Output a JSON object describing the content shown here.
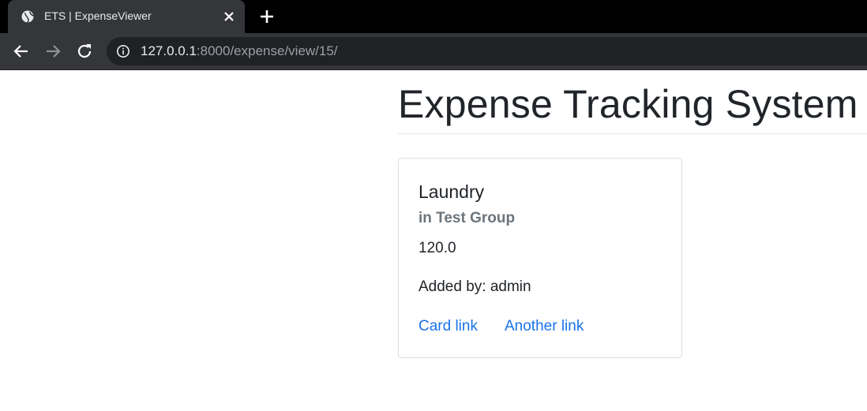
{
  "browser": {
    "tab": {
      "title": "ETS | ExpenseViewer",
      "favicon_icon": "globe-icon",
      "close_icon": "close-icon"
    },
    "new_tab_icon": "plus-icon",
    "nav": {
      "back_icon": "arrow-left-icon",
      "forward_icon": "arrow-right-icon",
      "reload_icon": "reload-icon"
    },
    "address_bar": {
      "info_icon": "info-icon",
      "host": "127.0.0.1",
      "path": ":8000/expense/view/15/"
    }
  },
  "page": {
    "title": "Expense Tracking System",
    "card": {
      "title": "Laundry",
      "subtitle": "in Test Group",
      "amount": "120.0",
      "added_by": "Added by: admin",
      "links": [
        "Card link",
        "Another link"
      ]
    }
  },
  "colors": {
    "link": "#1a73e8",
    "muted": "#6c757d",
    "text": "#212529",
    "chrome_dark": "#35363a"
  }
}
